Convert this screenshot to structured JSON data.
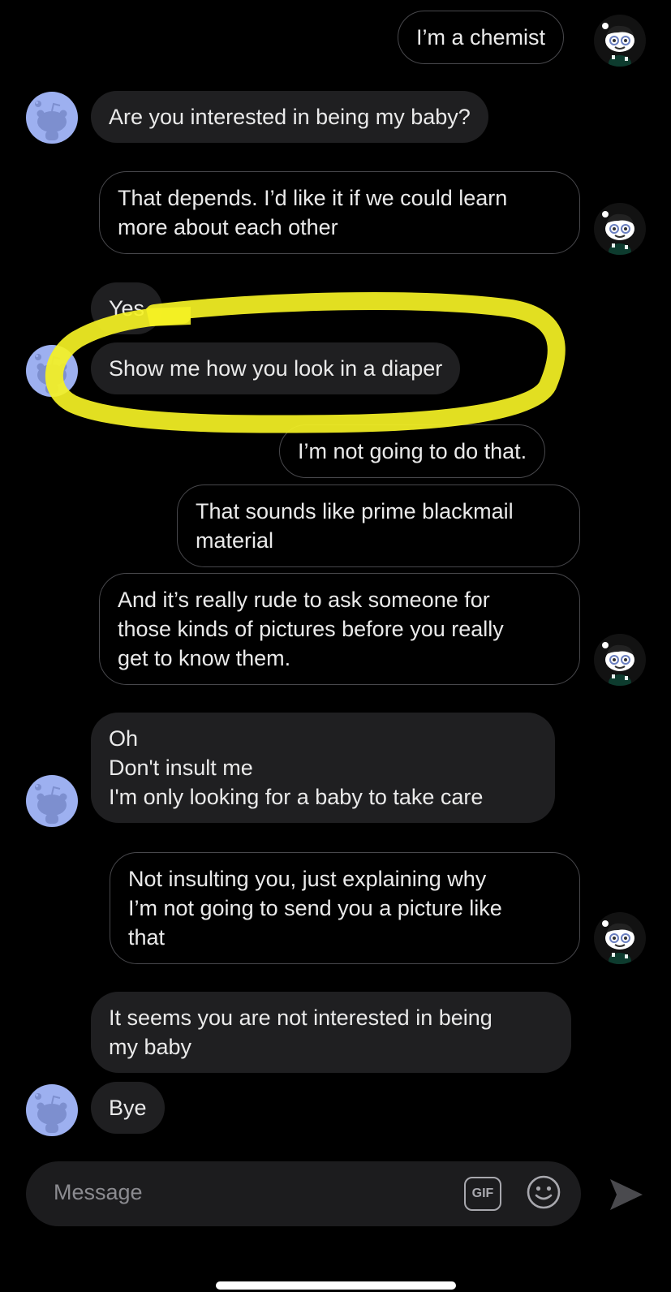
{
  "messages": [
    {
      "from": "me",
      "text": "I’m a chemist"
    },
    {
      "from": "them",
      "text": "Are you interested in being my baby?"
    },
    {
      "from": "me",
      "text": "That depends. I’d like it if we could learn\nmore about each other"
    },
    {
      "from": "them",
      "text": "Yes"
    },
    {
      "from": "them",
      "text": "Show me how you look in a diaper"
    },
    {
      "from": "me",
      "text": "I’m not going to do that."
    },
    {
      "from": "me",
      "text": "That sounds like prime blackmail\nmaterial"
    },
    {
      "from": "me",
      "text": "And it’s really rude to ask someone for\nthose kinds of pictures before you really\nget to know them."
    },
    {
      "from": "them",
      "text": "Oh\nDon't insult me\nI'm only looking for a baby to take care"
    },
    {
      "from": "me",
      "text": "Not insulting you, just explaining why\nI’m not going to send you a picture like\nthat"
    },
    {
      "from": "them",
      "text": "It seems you are not interested in being\nmy baby"
    },
    {
      "from": "them",
      "text": "Bye"
    }
  ],
  "composer": {
    "placeholder": "Message",
    "gif_label": "GIF",
    "icons": [
      "gif-icon",
      "emoji-icon",
      "send-icon"
    ]
  },
  "colors": {
    "background": "#000000",
    "incoming_bubble": "#1f1f21",
    "outgoing_border": "#48484c",
    "highlight": "#f5f224",
    "their_avatar": "#9db0f0"
  },
  "annotation": {
    "type": "highlighter-circle",
    "target_message": 4
  }
}
